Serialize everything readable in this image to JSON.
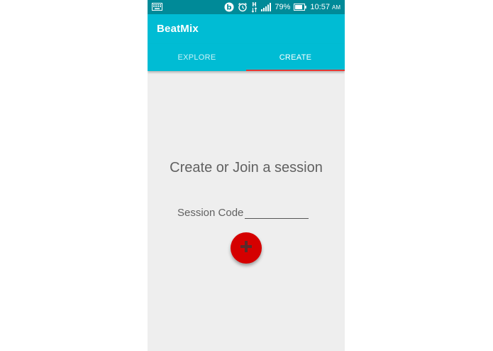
{
  "status_bar": {
    "battery_percent": "79%",
    "time": "10:57",
    "ampm": "AM",
    "icons": [
      "keyboard-icon",
      "beats-icon",
      "alarm-icon",
      "data-h-icon",
      "signal-icon",
      "battery-icon"
    ]
  },
  "app": {
    "title": "BeatMix"
  },
  "tabs": [
    {
      "label": "EXPLORE",
      "active": false
    },
    {
      "label": "CREATE",
      "active": true
    }
  ],
  "main": {
    "heading": "Create or Join a session",
    "session_label": "Session Code",
    "session_value": "",
    "fab_icon": "plus-icon"
  },
  "colors": {
    "status_bar": "#008a98",
    "primary": "#00bcd4",
    "accent": "#e53935",
    "fab": "#d50000",
    "background": "#eeeeee"
  }
}
